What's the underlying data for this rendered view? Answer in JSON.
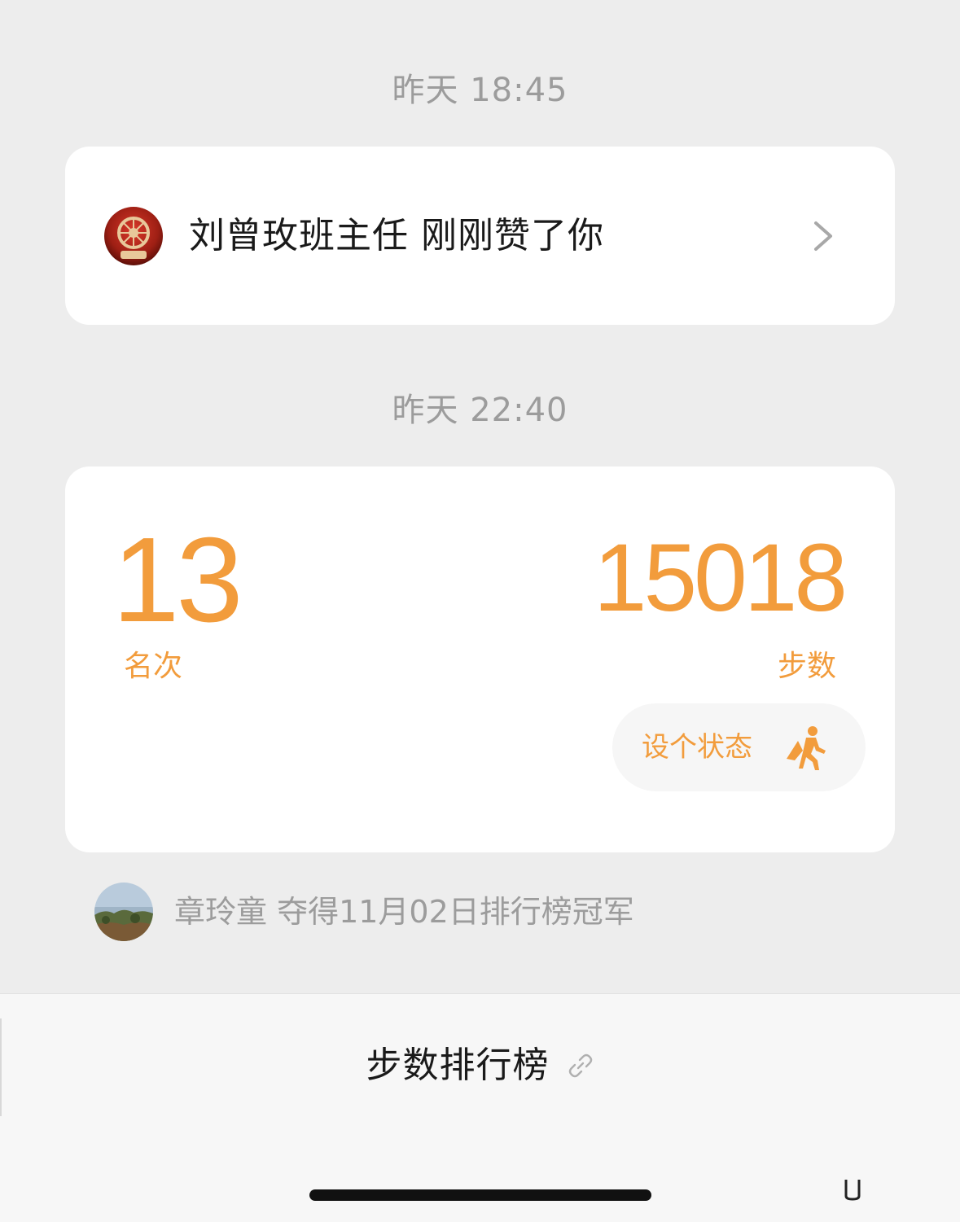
{
  "messages": [
    {
      "timestamp": "昨天 18:45",
      "like_notification": {
        "text": "刘曾玫班主任 刚刚赞了你",
        "avatar_icon": "dharma-wheel-avatar",
        "chevron_icon": "chevron-right-icon"
      }
    },
    {
      "timestamp": "昨天 22:40",
      "stats": {
        "rank": "13",
        "rank_label": "名次",
        "steps": "15018",
        "steps_label": "步数",
        "status_button": "设个状态",
        "status_icon": "walking-person-icon"
      },
      "champion": {
        "text": "章玲童 夺得11月02日排行榜冠军",
        "avatar_icon": "landscape-avatar"
      }
    }
  ],
  "bottom_bar": {
    "title": "步数排行榜",
    "link_icon": "link-icon"
  },
  "colors": {
    "accent": "#f29c3c",
    "timestamp": "#9c9c9c",
    "background": "#ededed",
    "card": "#ffffff"
  }
}
